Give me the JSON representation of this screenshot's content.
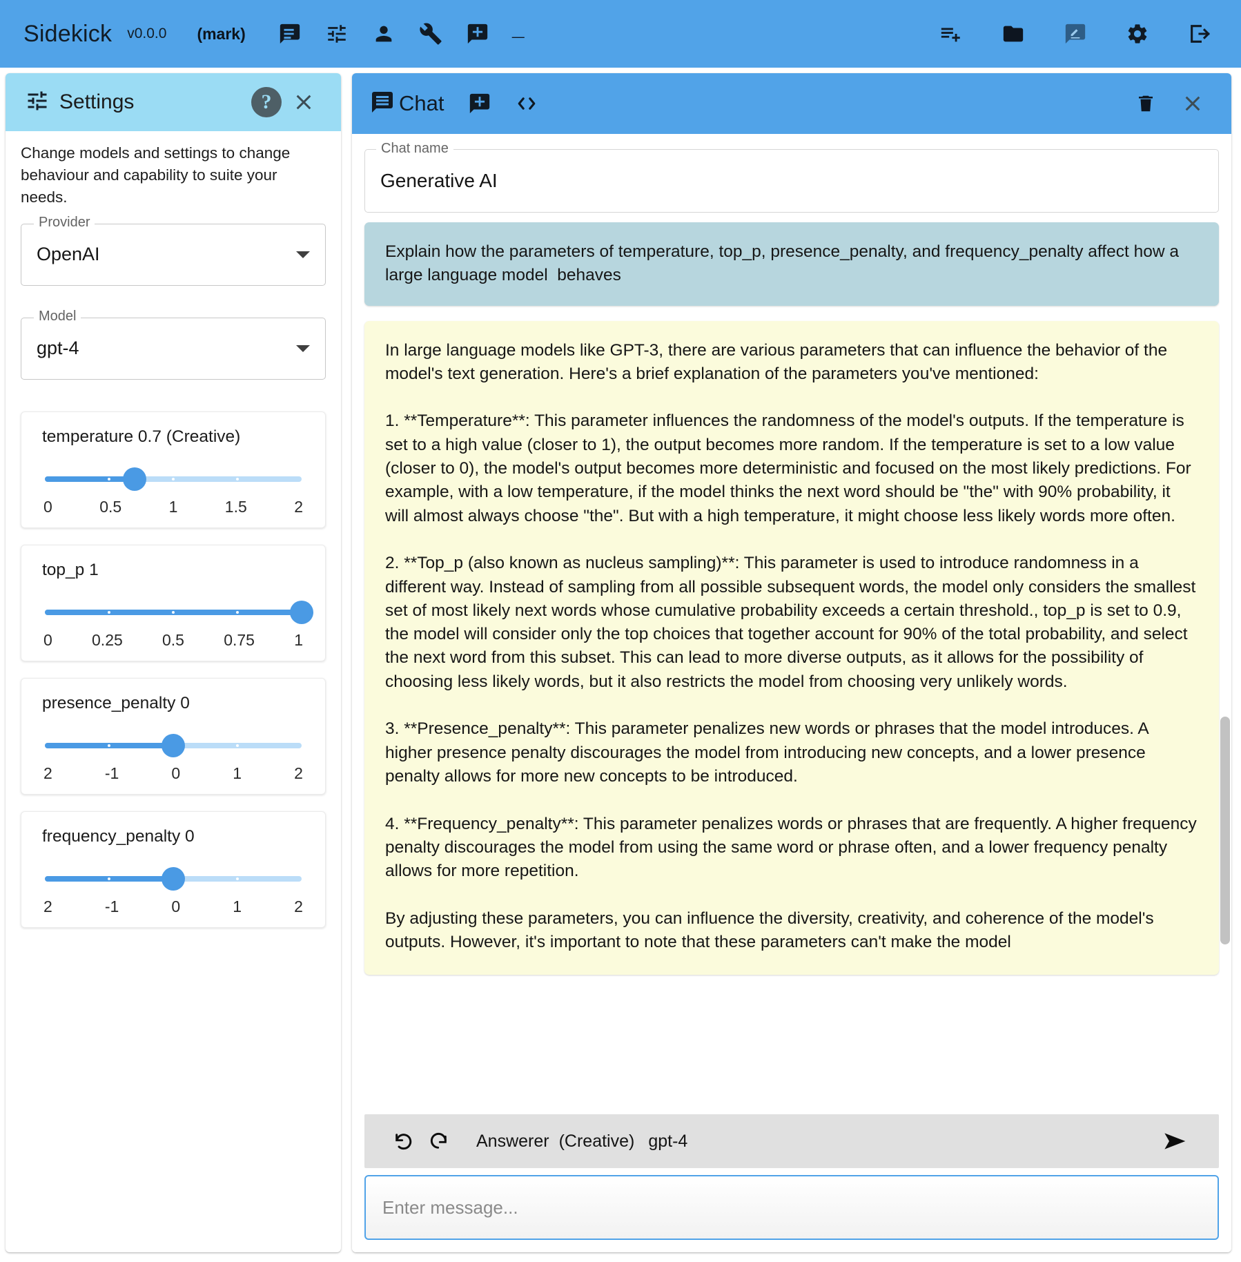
{
  "app": {
    "brand": "Sidekick",
    "version": "v0.0.0",
    "user": "(mark)",
    "minimize_glyph": "_",
    "left_icons": [
      {
        "name": "chat-icon",
        "label": "Chat"
      },
      {
        "name": "tune-icon",
        "label": "Settings"
      },
      {
        "name": "person-icon",
        "label": "Persona"
      },
      {
        "name": "wrench-icon",
        "label": "Tools"
      },
      {
        "name": "add-comment-icon",
        "label": "New chat"
      }
    ],
    "right_icons": [
      {
        "name": "playlist-add-icon",
        "label": "Add to playlist"
      },
      {
        "name": "folder-icon",
        "label": "Folder"
      },
      {
        "name": "edit-note-icon",
        "label": "Notes"
      },
      {
        "name": "gear-icon",
        "label": "Settings"
      },
      {
        "name": "logout-icon",
        "label": "Logout"
      }
    ]
  },
  "settings": {
    "title": "Settings",
    "help_glyph": "?",
    "close_glyph": "✕",
    "description": "Change models and settings to change behaviour and capability to suite your needs.",
    "provider": {
      "label": "Provider",
      "value": "OpenAI"
    },
    "model": {
      "label": "Model",
      "value": "gpt-4"
    },
    "sliders": [
      {
        "name": "temperature",
        "label": "temperature 0.7 (Creative)",
        "value": 0.7,
        "min": 0,
        "max": 2,
        "ticks": [
          "0",
          "0.5",
          "1",
          "1.5",
          "2"
        ],
        "fill_pct": 35
      },
      {
        "name": "top_p",
        "label": "top_p 1",
        "value": 1,
        "min": 0,
        "max": 1,
        "ticks": [
          "0",
          "0.25",
          "0.5",
          "0.75",
          "1"
        ],
        "fill_pct": 100
      },
      {
        "name": "presence_penalty",
        "label": "presence_penalty 0",
        "value": 0,
        "min": -2,
        "max": 2,
        "ticks": [
          "2",
          "-1",
          "0",
          "1",
          "2"
        ],
        "fill_pct": 50
      },
      {
        "name": "frequency_penalty",
        "label": "frequency_penalty 0",
        "value": 0,
        "min": -2,
        "max": 2,
        "ticks": [
          "2",
          "-1",
          "0",
          "1",
          "2"
        ],
        "fill_pct": 50
      }
    ]
  },
  "chat": {
    "title": "Chat",
    "code_glyph": "‹›",
    "delete_glyph": "delete-icon",
    "close_glyph": "✕",
    "name_label": "Chat name",
    "name_value": "Generative AI",
    "user_message": "Explain how the parameters of temperature, top_p, presence_penalty, and frequency_penalty affect how a large language model  behaves",
    "assistant_message": "In large language models like GPT-3, there are various parameters that can influence the behavior of the model's text generation. Here's a brief explanation of the parameters you've mentioned:\n\n1. **Temperature**: This parameter influences the randomness of the model's outputs. If the temperature is set to a high value (closer to 1), the output becomes more random. If the temperature is set to a low value (closer to 0), the model's output becomes more deterministic and focused on the most likely predictions. For example, with a low temperature, if the model thinks the next word should be \"the\" with 90% probability, it will almost always choose \"the\". But with a high temperature, it might choose less likely words more often.\n\n2. **Top_p (also known as nucleus sampling)**: This parameter is used to introduce randomness in a different way. Instead of sampling from all possible subsequent words, the model only considers the smallest set of most likely next words whose cumulative probability exceeds a certain threshold., top_p is set to 0.9, the model will consider only the top choices that together account for 90% of the total probability, and select the next word from this subset. This can lead to more diverse outputs, as it allows for the possibility of choosing less likely words, but it also restricts the model from choosing very unlikely words.\n\n3. **Presence_penalty**: This parameter penalizes new words or phrases that the model introduces. A higher presence penalty discourages the model from introducing new concepts, and a lower presence penalty allows for more new concepts to be introduced.\n\n4. **Frequency_penalty**: This parameter penalizes words or phrases that are frequently. A higher frequency penalty discourages the model from using the same word or phrase often, and a lower frequency penalty allows for more repetition.\n\nBy adjusting these parameters, you can influence the diversity, creativity, and coherence of the model's outputs. However, it's important to note that these parameters can't make the model",
    "toolbar": {
      "undo_glyph": "↺",
      "redo_glyph": "↷",
      "persona": "Answerer",
      "mode": "(Creative)",
      "model": "gpt-4",
      "send_glyph": "➤"
    },
    "input_placeholder": "Enter message..."
  },
  "colors": {
    "primary": "#51a3e8",
    "settings_header": "#9bdcf4",
    "user_bubble": "#b7d6de",
    "assistant_bubble": "#fbfbdc",
    "slider_fill": "#4a9ae4",
    "slider_track": "#bbddf8",
    "toolbar_bg": "#e0e0e0"
  }
}
